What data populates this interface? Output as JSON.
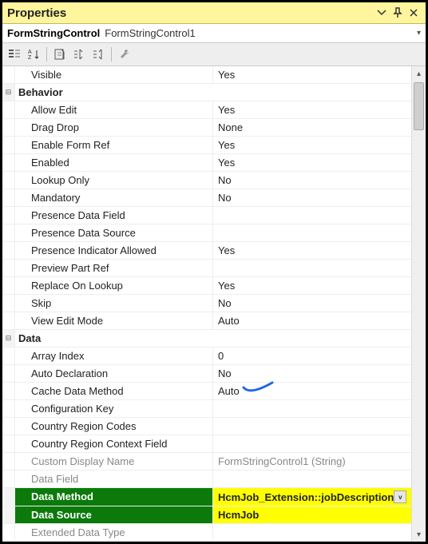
{
  "panel": {
    "title": "Properties"
  },
  "object": {
    "type": "FormStringControl",
    "name": "FormStringControl1"
  },
  "rows": [
    {
      "kind": "prop",
      "name": "Visible",
      "value": "Yes"
    },
    {
      "kind": "cat",
      "name": "Behavior"
    },
    {
      "kind": "prop",
      "name": "Allow Edit",
      "value": "Yes"
    },
    {
      "kind": "prop",
      "name": "Drag Drop",
      "value": "None"
    },
    {
      "kind": "prop",
      "name": "Enable Form Ref",
      "value": "Yes"
    },
    {
      "kind": "prop",
      "name": "Enabled",
      "value": "Yes"
    },
    {
      "kind": "prop",
      "name": "Lookup Only",
      "value": "No"
    },
    {
      "kind": "prop",
      "name": "Mandatory",
      "value": "No"
    },
    {
      "kind": "prop",
      "name": "Presence Data Field",
      "value": ""
    },
    {
      "kind": "prop",
      "name": "Presence Data Source",
      "value": ""
    },
    {
      "kind": "prop",
      "name": "Presence Indicator Allowed",
      "value": "Yes"
    },
    {
      "kind": "prop",
      "name": "Preview Part Ref",
      "value": ""
    },
    {
      "kind": "prop",
      "name": "Replace On Lookup",
      "value": "Yes"
    },
    {
      "kind": "prop",
      "name": "Skip",
      "value": "No"
    },
    {
      "kind": "prop",
      "name": "View Edit Mode",
      "value": "Auto"
    },
    {
      "kind": "cat",
      "name": "Data"
    },
    {
      "kind": "prop",
      "name": "Array Index",
      "value": "0"
    },
    {
      "kind": "prop",
      "name": "Auto Declaration",
      "value": "No"
    },
    {
      "kind": "prop",
      "name": "Cache Data Method",
      "value": "Auto",
      "annot": true
    },
    {
      "kind": "prop",
      "name": "Configuration Key",
      "value": ""
    },
    {
      "kind": "prop",
      "name": "Country Region Codes",
      "value": ""
    },
    {
      "kind": "prop",
      "name": "Country Region Context Field",
      "value": ""
    },
    {
      "kind": "prop",
      "name": "Custom Display Name",
      "value": "FormStringControl1 (String)",
      "dim": true
    },
    {
      "kind": "prop",
      "name": "Data Field",
      "value": "",
      "dim": true
    },
    {
      "kind": "prop",
      "name": "Data Method",
      "value": "HcmJob_Extension::jobDescription",
      "hl": true,
      "dd": true
    },
    {
      "kind": "prop",
      "name": "Data Source",
      "value": "HcmJob",
      "hl": true
    },
    {
      "kind": "prop",
      "name": "Extended Data Type",
      "value": "",
      "dim": true
    }
  ],
  "glyphs": {
    "collapse": "⊟",
    "dropdown": "▾",
    "up": "▴",
    "down": "▾"
  }
}
